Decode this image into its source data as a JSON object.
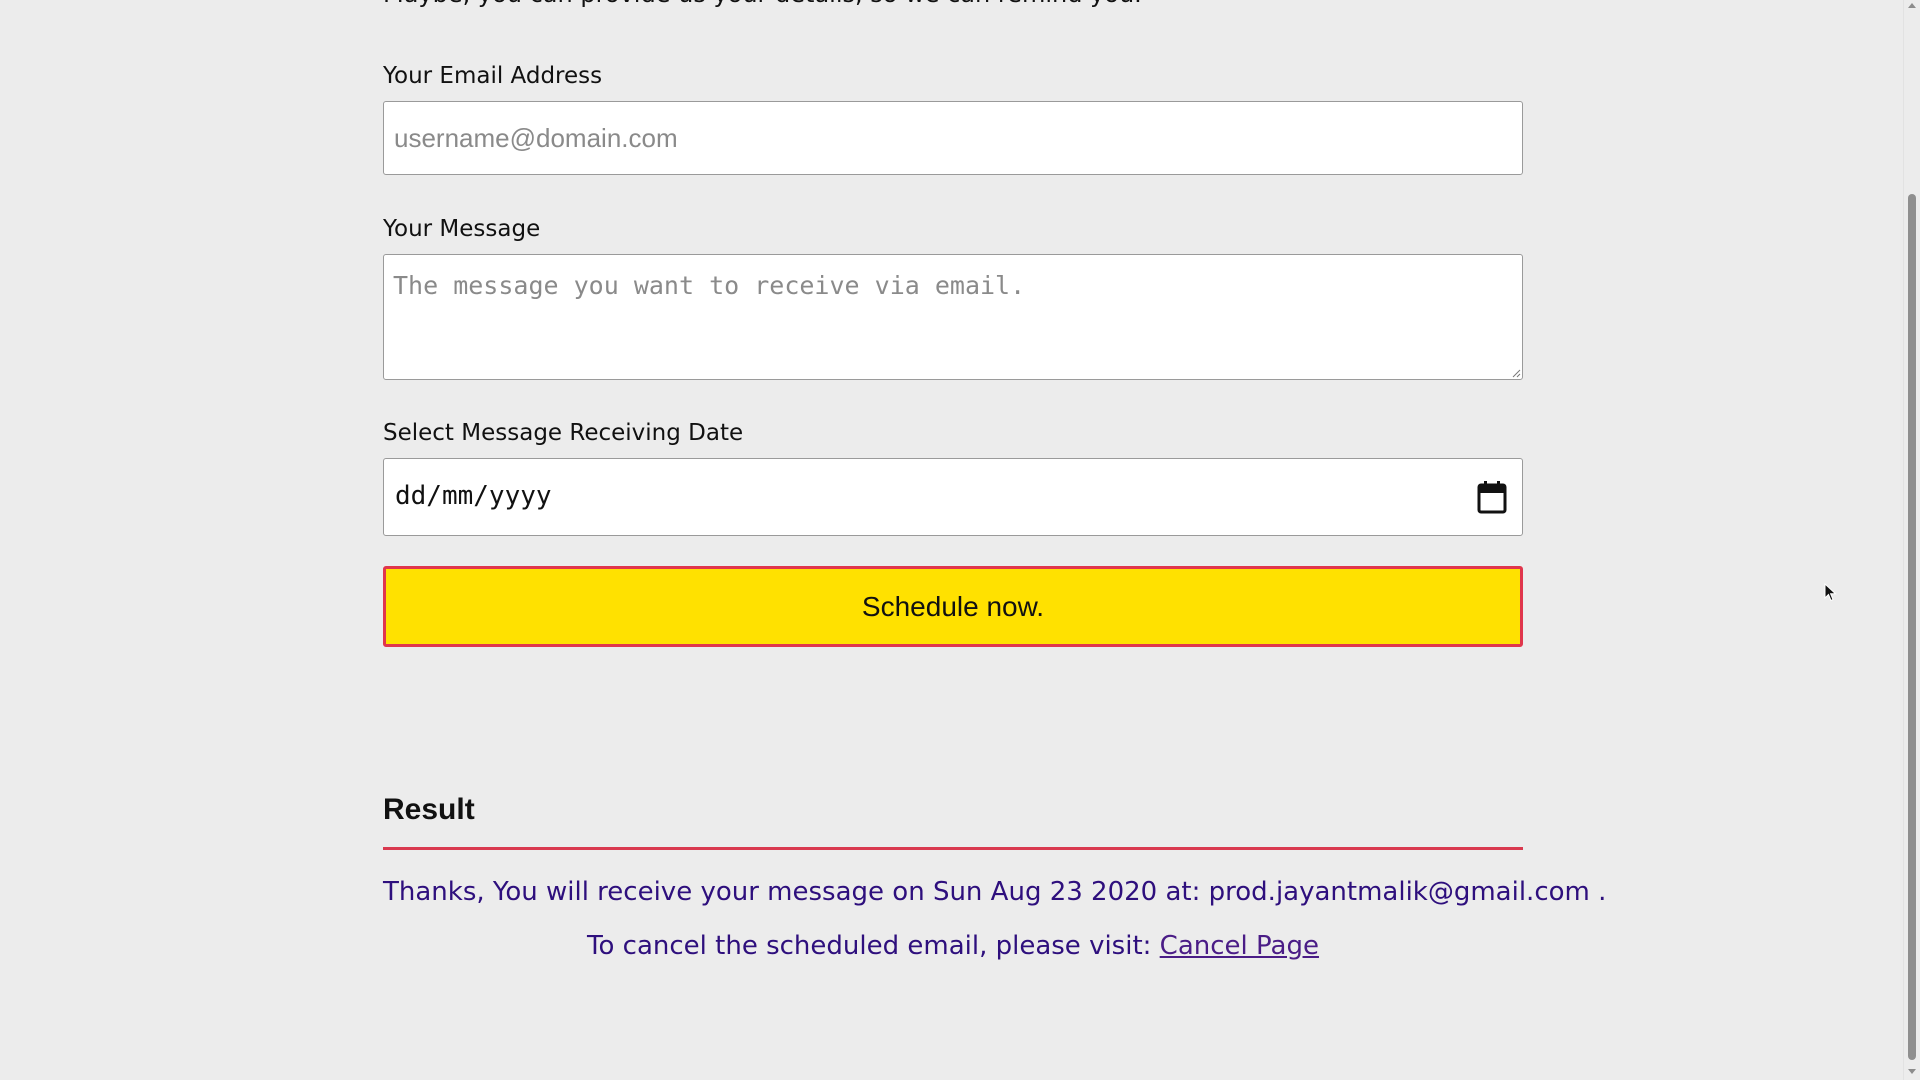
{
  "form": {
    "intro_text": "Maybe, you can provide us your details, so we can remind you.",
    "email_label": "Your Email Address",
    "email_placeholder": "username@domain.com",
    "email_value": "",
    "message_label": "Your Message",
    "message_placeholder": "The message you want to receive via email.",
    "message_value": "",
    "date_label": "Select Message Receiving Date",
    "date_placeholder": "dd/mm/yyyy",
    "submit_label": "Schedule now."
  },
  "result": {
    "heading": "Result",
    "confirmation": "Thanks, You will receive your message on Sun Aug 23 2020 at: prod.jayantmalik@gmail.com .",
    "cancel_prefix": "To cancel the scheduled email, please visit:",
    "cancel_link_label": "Cancel Page"
  },
  "colors": {
    "background": "#ececec",
    "button_fill": "#ffe100",
    "button_border": "#e0364c",
    "divider": "#d9394f",
    "result_text": "#2e0f7d"
  },
  "icons": {
    "date_picker": "calendar-icon",
    "resize": "resize-grip-icon",
    "cursor": "mouse-cursor-icon"
  }
}
